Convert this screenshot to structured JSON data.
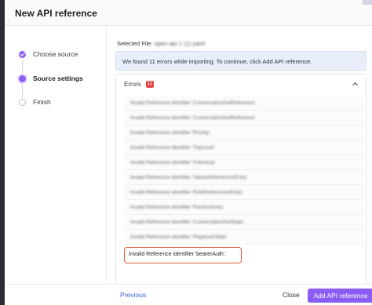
{
  "dialog": {
    "title": "New API reference"
  },
  "steps": [
    {
      "label": "Choose source",
      "state": "done"
    },
    {
      "label": "Source settings",
      "state": "current"
    },
    {
      "label": "Finish",
      "state": "pending"
    }
  ],
  "main": {
    "selected_file_label": "Selected File:",
    "selected_file_name": "open-api 1 (1).yaml",
    "info_message": "We found 11 errors while importing. To continue, click Add API reference.",
    "errors_title": "Errors",
    "errors_count": "11",
    "errors": [
      "Invalid Reference identifier 'ConversationSetReference'.",
      "Invalid Reference identifier 'ConversationSetReference'.",
      "Invalid Reference identifier 'Priority'.",
      "Invalid Reference identifier 'TopLevel'.",
      "Invalid Reference identifier 'FollowUp'.",
      "Invalid Reference identifier 'ValuesReferencesEntry'.",
      "Invalid Reference identifier 'RoleReferencesEntry'.",
      "Invalid Reference identifier 'ParamsEntry'.",
      "Invalid Reference identifier 'ConversationSetState'.",
      "Invalid Reference identifier 'PlaybookState'."
    ],
    "highlighted_error": "Invalid Reference identifier 'bearerAuth'."
  },
  "footer": {
    "previous_label": "Previous",
    "close_label": "Close",
    "add_label": "Add API reference"
  },
  "colors": {
    "accent": "#8b5cf6",
    "link": "#3e63dd",
    "error_badge": "#e5484d",
    "highlight_border": "#e05a3a",
    "banner_bg": "#e8effa"
  }
}
